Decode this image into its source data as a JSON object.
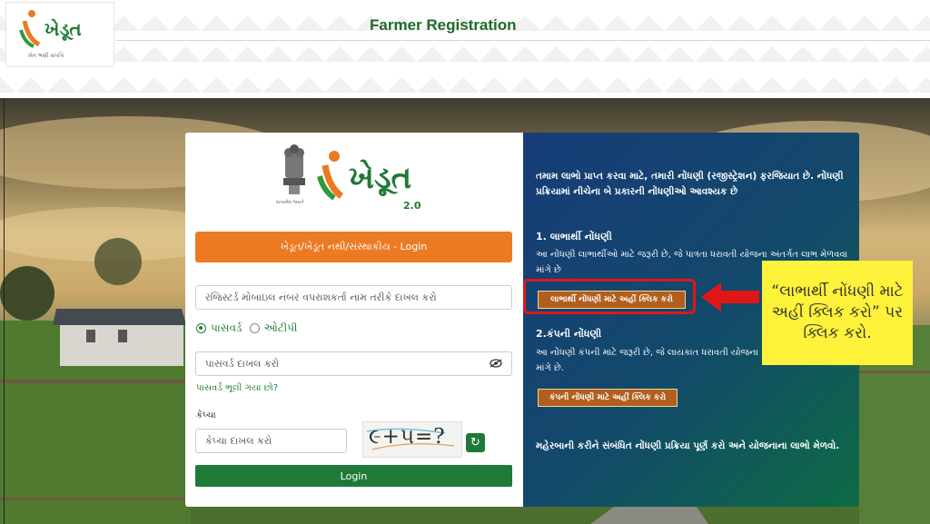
{
  "header": {
    "title": "Farmer Registration",
    "logo_text": "ખેડૂત",
    "logo_tagline": "ખેત ભણી સંપત્તિ"
  },
  "login": {
    "logo_text": "ખેડૂત",
    "logo_version": "2.0",
    "emblem_caption": "સત્યમેવ જયતે",
    "org_login_label": "ખેડૂત/ખેડૂત નથી/સંસ્થાકીય - Login",
    "mobile_placeholder": "રજિસ્ટર્ડ મોબાઇલ નંબર વપરાશકર્તા નામ તરીકે દાખલ કરો",
    "radio_password": "પાસવર્ડ",
    "radio_otp": "ઓટીપી",
    "password_placeholder": "પાસવર્ડ દાખલ કરો",
    "forgot_password": "પાસવર્ડ ભૂલી ગયા છો?",
    "captcha_label": "કેપ્ચા",
    "captcha_placeholder": "કેપ્ચા દાખલ કરો",
    "captcha_text": "૯+૫=?",
    "login_button": "Login"
  },
  "info": {
    "intro": "તમામ લાભો પ્રાપ્ત કરવા માટે, તમારી નોંધણી (રજીસ્ટ્રેશન) ફરજિયાત છે. નોંધણી પ્રક્રિયામાં નીચેના બે પ્રકારની નોંધણીઓ આવશ્યક છે",
    "section1_title": "1. લાભાર્થી નોંધણી",
    "section1_desc": "આ નોંધણી લાભાર્થીઓ માટે જરૂરી છે, જે પાત્રતા ધરાવતી યોજના અંતર્ગત લાભ મેળવવા માંગે છે",
    "section1_button": "લાભાર્થી નોંધણી માટે અહીં ક્લિક કરો",
    "section2_title": "2.કંપની નોંધણી",
    "section2_desc": "આ નોંધણી કંપની માટે જરૂરી છે, જે લાયકાત ધરાવતી યોજના માંગે છે.",
    "section2_button": "કંપની નોંધણી માટે અહીં ક્લિક કરો",
    "footer": "મહેરબાની કરીને સંબંધિત નોંધણી પ્રક્રિયા પૂર્ણ કરો અને યોજનાના લાભો મેળવો."
  },
  "annotation": {
    "callout_text": "“લાભાર્થી નોંધણી માટે અહીં ક્લિક કરો” પર ક્લિક કરો.",
    "arrow_color": "#e01717",
    "callout_color": "#fff23a"
  },
  "colors": {
    "green": "#1f7a38",
    "orange": "#ec7a22",
    "panel_blue": "#173c78"
  }
}
